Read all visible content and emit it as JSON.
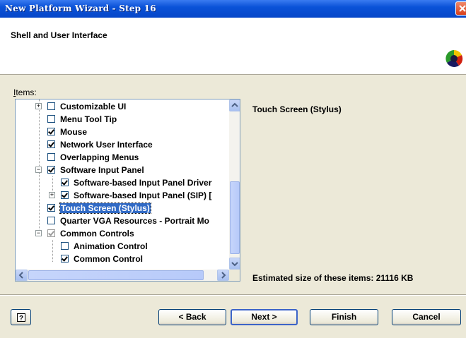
{
  "window": {
    "title": "New Platform Wizard - Step 16"
  },
  "header": {
    "title": "Shell and User Interface"
  },
  "items_label": "Items:",
  "tree": {
    "items": [
      {
        "label": "Customizable UI",
        "checked": false,
        "expander": "+"
      },
      {
        "label": "Menu Tool Tip",
        "checked": false
      },
      {
        "label": "Mouse",
        "checked": true
      },
      {
        "label": "Network User Interface",
        "checked": true
      },
      {
        "label": "Overlapping Menus",
        "checked": false
      },
      {
        "label": "Software Input Panel",
        "checked": true,
        "expander": "−"
      },
      {
        "label": "Software-based Input Panel Driver",
        "checked": true
      },
      {
        "label": "Software-based Input Panel (SIP) [",
        "checked": true,
        "expander": "+"
      },
      {
        "label": "Touch Screen (Stylus)",
        "checked": true,
        "selected": true
      },
      {
        "label": "Quarter VGA Resources - Portrait Mo",
        "checked": false
      },
      {
        "label": "Common Controls",
        "checked": true,
        "expander": "−",
        "greyed": true
      },
      {
        "label": "Animation Control",
        "checked": false
      },
      {
        "label": "Common Control",
        "checked": true
      }
    ]
  },
  "description": {
    "title": "Touch Screen (Stylus)"
  },
  "estimate": "Estimated size of these items: 21116 KB",
  "buttons": {
    "help": "?",
    "back": "< Back",
    "next": "Next >",
    "finish": "Finish",
    "cancel": "Cancel"
  },
  "colors": {
    "titlebar": "#0a52d8",
    "selection": "#316ac5",
    "dialog_bg": "#ece9d8"
  }
}
